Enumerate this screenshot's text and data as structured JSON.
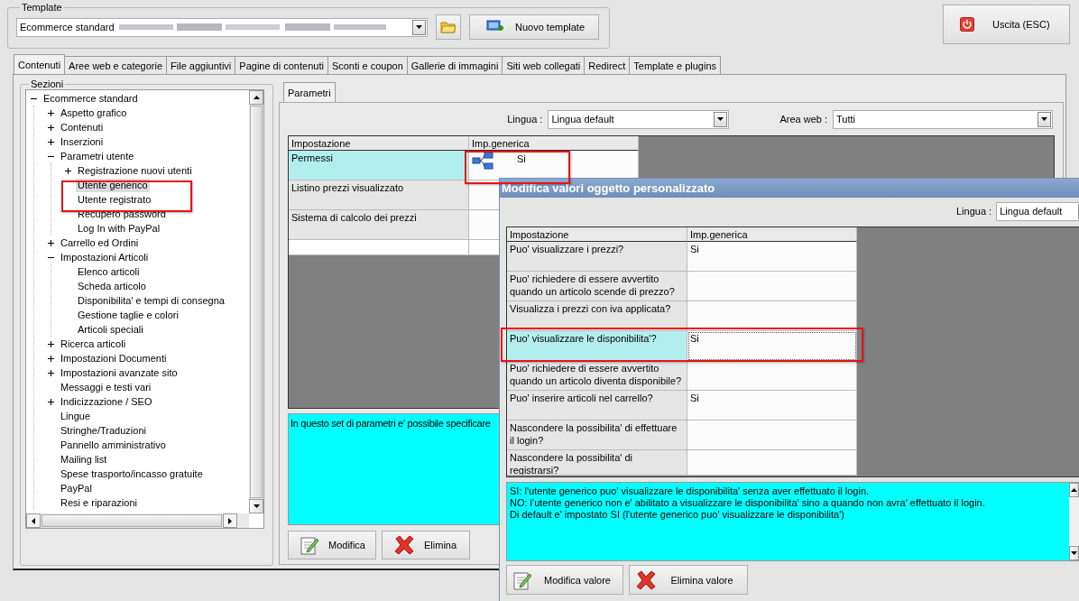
{
  "template": {
    "title": "Template",
    "combo_value": "Ecommerce standard",
    "new_button": "Nuovo template",
    "exit_button": "Uscita (ESC)"
  },
  "tabs": [
    {
      "label": "Contenuti",
      "selected": true
    },
    {
      "label": "Aree web e categorie",
      "selected": false
    },
    {
      "label": "File aggiuntivi",
      "selected": false
    },
    {
      "label": "Pagine di contenuti",
      "selected": false
    },
    {
      "label": "Sconti e coupon",
      "selected": false
    },
    {
      "label": "Gallerie di immagini",
      "selected": false
    },
    {
      "label": "Siti web collegati",
      "selected": false
    },
    {
      "label": "Redirect",
      "selected": false
    },
    {
      "label": "Template e plugins",
      "selected": false
    }
  ],
  "sections": {
    "title": "Sezioni",
    "tree": [
      {
        "label": "Ecommerce standard",
        "expanded": true,
        "selected": false,
        "children": [
          {
            "label": "Aspetto grafico",
            "expanded": false,
            "selected": false
          },
          {
            "label": "Contenuti",
            "expanded": false,
            "selected": false
          },
          {
            "label": "Inserzioni",
            "expanded": false,
            "selected": false
          },
          {
            "label": "Parametri utente",
            "expanded": true,
            "selected": false,
            "children": [
              {
                "label": "Registrazione nuovi utenti",
                "expanded": false,
                "selected": false
              },
              {
                "label": "Utente generico",
                "selected": true
              },
              {
                "label": "Utente registrato",
                "selected": false
              },
              {
                "label": "Recupero password",
                "selected": false
              },
              {
                "label": "Log In with PayPal",
                "selected": false
              }
            ]
          },
          {
            "label": "Carrello ed Ordini",
            "expanded": false,
            "selected": false
          },
          {
            "label": "Impostazioni Articoli",
            "expanded": true,
            "selected": false,
            "children": [
              {
                "label": "Elenco articoli",
                "selected": false
              },
              {
                "label": "Scheda articolo",
                "selected": false
              },
              {
                "label": "Disponibilita' e tempi di consegna",
                "selected": false
              },
              {
                "label": "Gestione taglie e colori",
                "selected": false
              },
              {
                "label": "Articoli speciali",
                "selected": false
              }
            ]
          },
          {
            "label": "Ricerca articoli",
            "expanded": false,
            "selected": false
          },
          {
            "label": "Impostazioni Documenti",
            "expanded": false,
            "selected": false
          },
          {
            "label": "Impostazioni avanzate sito",
            "expanded": false,
            "selected": false
          },
          {
            "label": "Messaggi e testi vari",
            "selected": false
          },
          {
            "label": "Indicizzazione / SEO",
            "expanded": false,
            "selected": false
          },
          {
            "label": "Lingue",
            "selected": false
          },
          {
            "label": "Stringhe/Traduzioni",
            "selected": false
          },
          {
            "label": "Pannello amministrativo",
            "selected": false
          },
          {
            "label": "Mailing list",
            "selected": false
          },
          {
            "label": "Spese trasporto/incasso gratuite",
            "selected": false
          },
          {
            "label": "PayPal",
            "selected": false
          },
          {
            "label": "Resi e riparazioni",
            "selected": false
          }
        ]
      }
    ]
  },
  "parameters": {
    "tab": {
      "label": "Parametri",
      "selected": true
    },
    "lingua_label": "Lingua :",
    "lingua_value": "Lingua default",
    "area_label": "Area web :",
    "area_value": "Tutti",
    "columns": [
      "Impostazione",
      "Imp.generica"
    ],
    "rows": [
      {
        "setting": "Permessi",
        "value": "Si",
        "kind": "tree-value",
        "selected": true
      },
      {
        "setting": "Listino prezzi visualizzato",
        "kind": "text",
        "selected": false
      },
      {
        "setting": "Sistema di calcolo dei prezzi",
        "kind": "text",
        "selected": false
      }
    ],
    "description": "In questo set di parametri e' possibile specificare",
    "buttons": [
      {
        "label": "Modifica",
        "kind": "edit"
      },
      {
        "label": "Elimina",
        "kind": "delete"
      }
    ]
  },
  "dialog": {
    "title": "Modifica valori oggetto personalizzato",
    "lingua_label": "Lingua :",
    "lingua_value": "Lingua default",
    "columns": [
      "Impostazione",
      "Imp.generica"
    ],
    "rows": [
      {
        "setting": "Puo' visualizzare i prezzi?",
        "value": "Si",
        "selected": false
      },
      {
        "setting": "Puo' richiedere di essere avvertito quando un articolo scende di prezzo?",
        "selected": false
      },
      {
        "setting": "Visualizza i prezzi con iva applicata?",
        "selected": false
      },
      {
        "setting": "Puo' visualizzare le disponibilita'?",
        "value": "Si",
        "selected": true
      },
      {
        "setting": "Puo' richiedere di essere avvertito quando un articolo diventa disponibile?",
        "selected": false
      },
      {
        "setting": "Puo' inserire articoli nel carrello?",
        "value": "Si",
        "selected": false
      },
      {
        "setting": "Nascondere la possibilita' di effettuare il login?",
        "selected": false
      },
      {
        "setting": "Nascondere la possibilita' di registrarsi?",
        "selected": false
      }
    ],
    "description": [
      "SI: l'utente generico puo' visualizzare le disponibilita' senza aver effettuato il login.",
      "NO: l'utente generico non e' abilitato a visualizzare le disponibilita' sino a quando non avra' effettuato il login.",
      "Di default e' impostato SI (l'utente generico puo' visualizzare le disponibilita')"
    ],
    "buttons": [
      {
        "label": "Modifica valore",
        "kind": "edit"
      },
      {
        "label": "Elimina valore",
        "kind": "delete"
      }
    ]
  },
  "annotations": [
    {
      "kind": "tree"
    },
    {
      "kind": "grid-cell"
    },
    {
      "kind": "dialog-row"
    }
  ]
}
